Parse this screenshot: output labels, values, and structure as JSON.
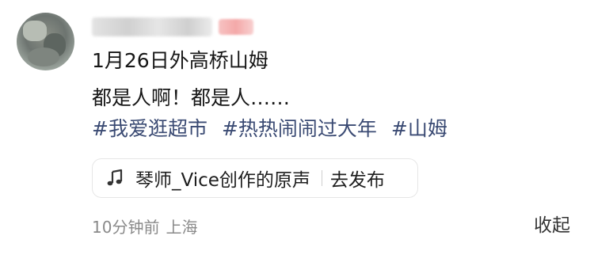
{
  "post": {
    "line1": "1月26日外高桥山姆",
    "line2": "都是人啊！都是人……",
    "hashtags": [
      "#我爱逛超市",
      "#热热闹闹过大年",
      "#山姆"
    ]
  },
  "music": {
    "icon": "music-note-icon",
    "label": "琴师_Vice创作的原声",
    "action": "去发布"
  },
  "meta": {
    "time": "10分钟前",
    "location": "上海"
  },
  "collapse_label": "收起"
}
